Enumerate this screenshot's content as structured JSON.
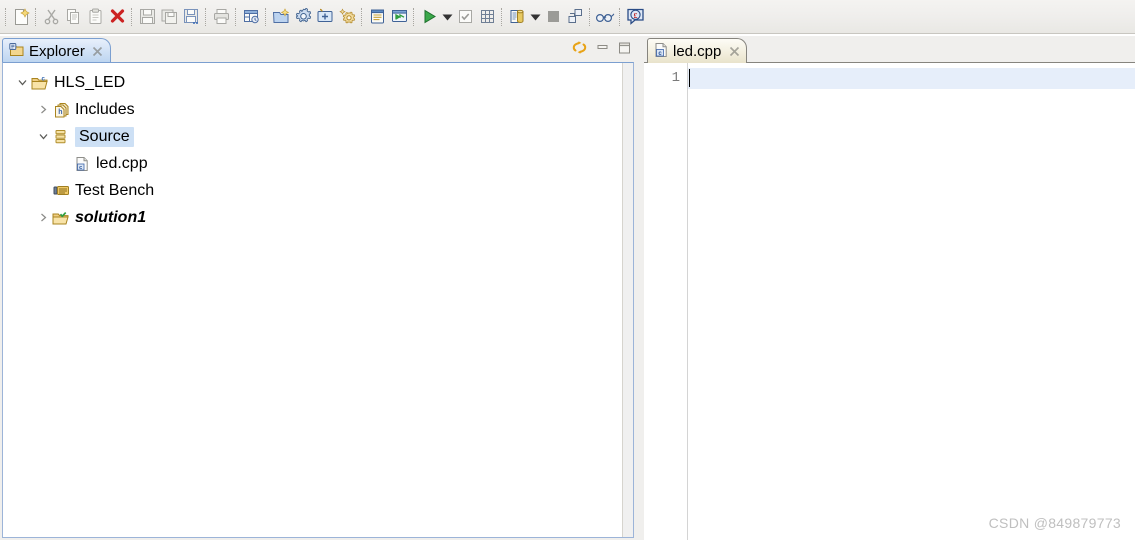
{
  "toolbar": {
    "groups": [
      {
        "name": "file-group",
        "items": [
          {
            "icon": "new-file-icon",
            "label": "New"
          },
          {
            "icon": "cut-icon",
            "label": "Cut"
          },
          {
            "icon": "copy-icon",
            "label": "Copy"
          },
          {
            "icon": "paste-icon",
            "label": "Paste"
          },
          {
            "icon": "delete-icon",
            "label": "Delete"
          }
        ]
      },
      {
        "name": "save-group",
        "items": [
          {
            "icon": "save-icon",
            "label": "Save"
          },
          {
            "icon": "save-as-icon",
            "label": "Save As"
          },
          {
            "icon": "save-all-icon",
            "label": "Save All"
          }
        ]
      },
      {
        "name": "print-group",
        "items": [
          {
            "icon": "print-icon",
            "label": "Print"
          }
        ]
      },
      {
        "name": "layout-group",
        "items": [
          {
            "icon": "table-layout-icon",
            "label": "Open Layout"
          }
        ]
      },
      {
        "name": "project-group",
        "items": [
          {
            "icon": "new-project-icon",
            "label": "New Project"
          },
          {
            "icon": "project-settings-icon",
            "label": "Project Settings"
          },
          {
            "icon": "new-solution-icon",
            "label": "New Solution"
          },
          {
            "icon": "solution-settings-icon",
            "label": "Solution Settings"
          }
        ]
      },
      {
        "name": "report-group",
        "items": [
          {
            "icon": "report-icon",
            "label": "Open Report"
          },
          {
            "icon": "wave-viewer-icon",
            "label": "Open Wave Viewer"
          }
        ]
      },
      {
        "name": "run-group",
        "items": [
          {
            "icon": "run-icon",
            "label": "Run C Simulation"
          },
          {
            "icon": "chevron-down-icon",
            "label": "Run Options"
          },
          {
            "icon": "csynth-icon",
            "label": "Run C Synthesis"
          },
          {
            "icon": "cosim-icon",
            "label": "Run C/RTL Cosimulation"
          }
        ]
      },
      {
        "name": "export-group",
        "items": [
          {
            "icon": "export-rtl-icon",
            "label": "Export RTL"
          },
          {
            "icon": "chevron-down-icon",
            "label": "Export Options"
          },
          {
            "icon": "stop-icon",
            "label": "Stop"
          },
          {
            "icon": "perspective-icon",
            "label": "Open Perspective"
          }
        ]
      },
      {
        "name": "view-group",
        "items": [
          {
            "icon": "glasses-icon",
            "label": "Inspect"
          }
        ]
      },
      {
        "name": "help-group",
        "items": [
          {
            "icon": "help-bubble-icon",
            "label": "Help"
          }
        ]
      }
    ]
  },
  "explorer": {
    "tab": {
      "label": "Explorer",
      "icon": "explorer-icon",
      "close_icon": "close-icon"
    },
    "view_buttons": [
      {
        "icon": "link-with-editor-icon",
        "label": "Link with Editor"
      },
      {
        "icon": "minimize-icon",
        "label": "Minimize"
      },
      {
        "icon": "maximize-icon",
        "label": "Maximize"
      }
    ],
    "tree": [
      {
        "label": "HLS_LED",
        "icon": "cpp-project-folder-icon",
        "twisty": "expanded",
        "indent": 1,
        "selected": false,
        "style": "normal"
      },
      {
        "label": "Includes",
        "icon": "includes-icon",
        "twisty": "collapsed",
        "indent": 2,
        "selected": false,
        "style": "normal"
      },
      {
        "label": "Source",
        "icon": "source-folder-icon",
        "twisty": "expanded",
        "indent": 2,
        "selected": true,
        "style": "normal"
      },
      {
        "label": "led.cpp",
        "icon": "cpp-file-icon",
        "twisty": "none",
        "indent": 3,
        "selected": false,
        "style": "normal"
      },
      {
        "label": "Test Bench",
        "icon": "test-bench-icon",
        "twisty": "none",
        "indent": 2,
        "selected": false,
        "style": "normal"
      },
      {
        "label": "solution1",
        "icon": "active-solution-folder-icon",
        "twisty": "collapsed",
        "indent": 2,
        "selected": false,
        "style": "bolditalic"
      }
    ]
  },
  "editor": {
    "tab": {
      "label": "led.cpp",
      "icon": "cpp-file-icon",
      "close_icon": "close-icon"
    },
    "line_numbers": [
      "1"
    ],
    "content_lines": [
      ""
    ],
    "current_line": 1
  },
  "watermark": {
    "text": "CSDN @849879773"
  },
  "colors": {
    "accent_blue": "#cde0f5",
    "tab_active_border": "#7b9fd0",
    "current_line": "#e6eefa",
    "toolbar_bg": "#efeeec",
    "delete_red": "#cc2222",
    "run_green": "#2f9e3f",
    "folder_gold": "#e8b23c"
  }
}
